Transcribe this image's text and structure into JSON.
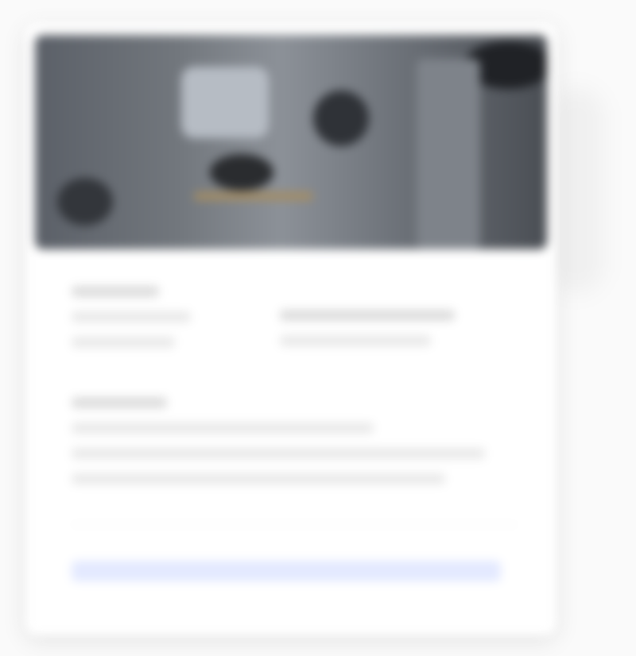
{
  "card": {
    "hero": {},
    "details": {},
    "link": {}
  }
}
